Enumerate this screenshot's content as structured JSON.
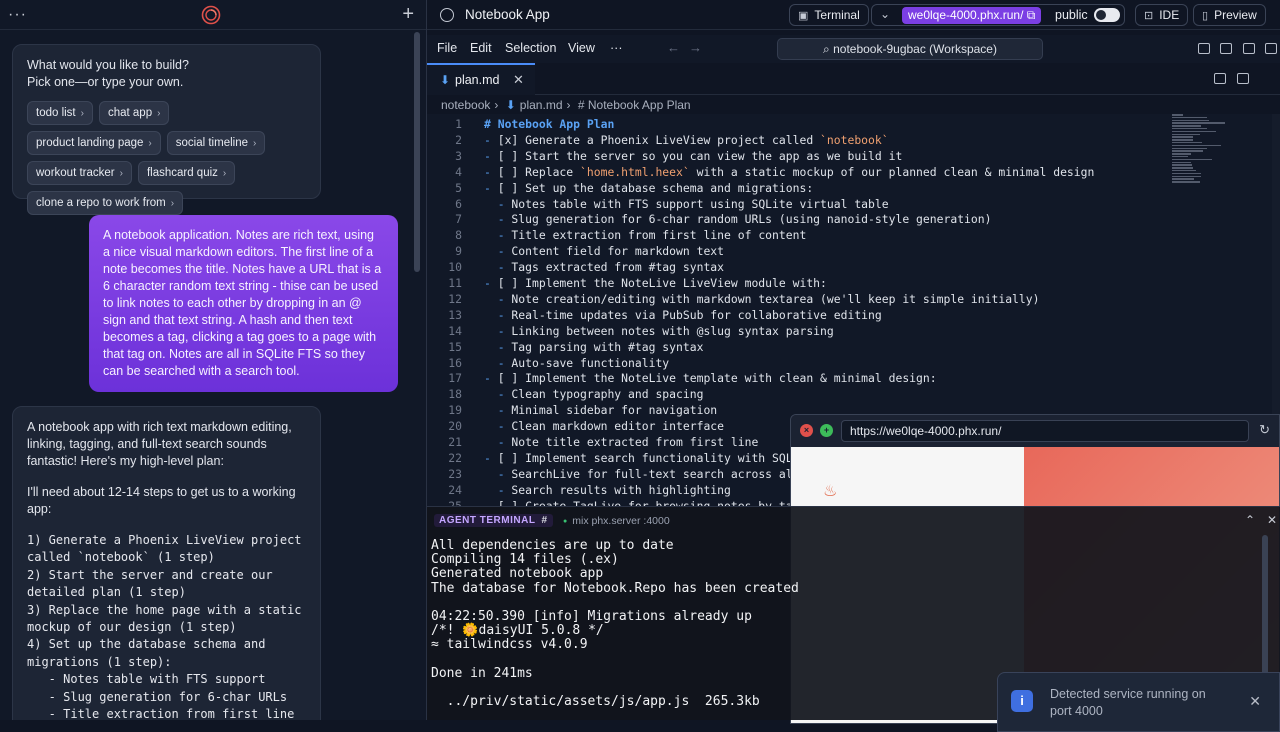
{
  "chat": {
    "suggest_question": "What would you like to build?",
    "suggest_sub": "Pick one—or type your own.",
    "chips": [
      "todo list",
      "chat app",
      "product landing page",
      "social timeline",
      "workout tracker",
      "flashcard quiz",
      "clone a repo to work from"
    ],
    "user_message": "A notebook application. Notes are rich text, using a nice visual markdown editors. The first line of a note becomes the title. Notes have a URL that is a 6 character random text string - thise can be used to link notes to each other by dropping in an @ sign and that text string. A hash and then text becomes a tag, clicking a tag goes to a page with that tag on. Notes are all in SQLite FTS so they can be searched with a search tool.",
    "ai_intro": "A notebook app with rich text markdown editing, linking, tagging, and full-text search sounds fantastic! Here's my high-level plan:",
    "ai_steps_intro": "I'll need about 12-14 steps to get us to a working app:",
    "ai_plan": "1) Generate a Phoenix LiveView project\ncalled `notebook` (1 step)\n2) Start the server and create our\ndetailed plan (1 step)\n3) Replace the home page with a static\nmockup of our design (1 step)\n4) Set up the database schema and\nmigrations (1 step):\n   - Notes table with FTS support\n   - Slug generation for 6-char URLs\n   - Title extraction from first line"
  },
  "topbar": {
    "app_title": "Notebook App",
    "terminal_label": "Terminal",
    "url_label": "we0lqe-4000.phx.run/",
    "visibility_label": "public",
    "ide_label": "IDE",
    "preview_label": "Preview"
  },
  "menubar": {
    "items": [
      "File",
      "Edit",
      "Selection",
      "View",
      "···"
    ],
    "search": "notebook-9ugbac (Workspace)"
  },
  "tab": {
    "label": "plan.md",
    "close": "✕"
  },
  "breadcrumb": {
    "root": "notebook",
    "file": "plan.md",
    "symbol": "# Notebook App Plan"
  },
  "editor": {
    "lines": [
      {
        "n": "1",
        "t": "# Notebook App Plan"
      },
      {
        "n": "2",
        "t": "- [x] Generate a Phoenix LiveView project called `notebook`"
      },
      {
        "n": "3",
        "t": "- [ ] Start the server so you can view the app as we build it"
      },
      {
        "n": "4",
        "t": "- [ ] Replace `home.html.heex` with a static mockup of our planned clean & minimal design"
      },
      {
        "n": "5",
        "t": "- [ ] Set up the database schema and migrations:"
      },
      {
        "n": "6",
        "t": "  - Notes table with FTS support using SQLite virtual table"
      },
      {
        "n": "7",
        "t": "  - Slug generation for 6-char random URLs (using nanoid-style generation)"
      },
      {
        "n": "8",
        "t": "  - Title extraction from first line of content"
      },
      {
        "n": "9",
        "t": "  - Content field for markdown text"
      },
      {
        "n": "10",
        "t": "  - Tags extracted from #tag syntax"
      },
      {
        "n": "11",
        "t": "- [ ] Implement the NoteLive LiveView module with:"
      },
      {
        "n": "12",
        "t": "  - Note creation/editing with markdown textarea (we'll keep it simple initially)"
      },
      {
        "n": "13",
        "t": "  - Real-time updates via PubSub for collaborative editing"
      },
      {
        "n": "14",
        "t": "  - Linking between notes with @slug syntax parsing"
      },
      {
        "n": "15",
        "t": "  - Tag parsing with #tag syntax"
      },
      {
        "n": "16",
        "t": "  - Auto-save functionality"
      },
      {
        "n": "17",
        "t": "- [ ] Implement the NoteLive template with clean & minimal design:"
      },
      {
        "n": "18",
        "t": "  - Clean typography and spacing"
      },
      {
        "n": "19",
        "t": "  - Minimal sidebar for navigation"
      },
      {
        "n": "20",
        "t": "  - Clean markdown editor interface"
      },
      {
        "n": "21",
        "t": "  - Note title extracted from first line"
      },
      {
        "n": "22",
        "t": "- [ ] Implement search functionality with SQLite"
      },
      {
        "n": "23",
        "t": "  - SearchLive for full-text search across all n"
      },
      {
        "n": "24",
        "t": "  - Search results with highlighting"
      },
      {
        "n": "25",
        "t": "- [ ] Create TagLive for browsing notes by tag:"
      }
    ]
  },
  "preview": {
    "address": "https://we0lqe-4000.phx.run/",
    "close_icon": "×",
    "expand_icon": "+"
  },
  "terminal": {
    "tab_label": "AGENT TERMINAL",
    "tab_hash": "#",
    "process": "mix phx.server :4000",
    "output": "All dependencies are up to date\nCompiling 14 files (.ex)\nGenerated notebook app\nThe database for Notebook.Repo has been created\n\n04:22:50.390 [info] Migrations already up\n/*! 🌼daisyUI 5.0.8 */\n≈ tailwindcss v4.0.9\n\nDone in 241ms\n\n  ../priv/static/assets/js/app.js  265.3kb"
  },
  "toast": {
    "message": "Detected service running on port 4000"
  }
}
